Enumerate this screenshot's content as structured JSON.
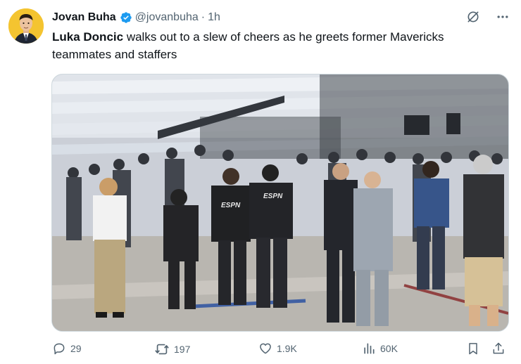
{
  "author": {
    "name": "Jovan Buha",
    "handle": "@jovanbuha",
    "separator": "·",
    "time": "1h"
  },
  "tweet": {
    "bold_lead": "Luka Doncic",
    "body": " walks out to a slew of cheers as he greets former Mavericks teammates and staffers"
  },
  "media": {
    "shirt_logo_1": "ESPN",
    "shirt_logo_2": "ESPN"
  },
  "actions": {
    "replies": "29",
    "reposts": "197",
    "likes": "1.9K",
    "views": "60K"
  },
  "colors": {
    "text": "#0f1419",
    "muted": "#536471",
    "verified": "#1d9bf0"
  }
}
